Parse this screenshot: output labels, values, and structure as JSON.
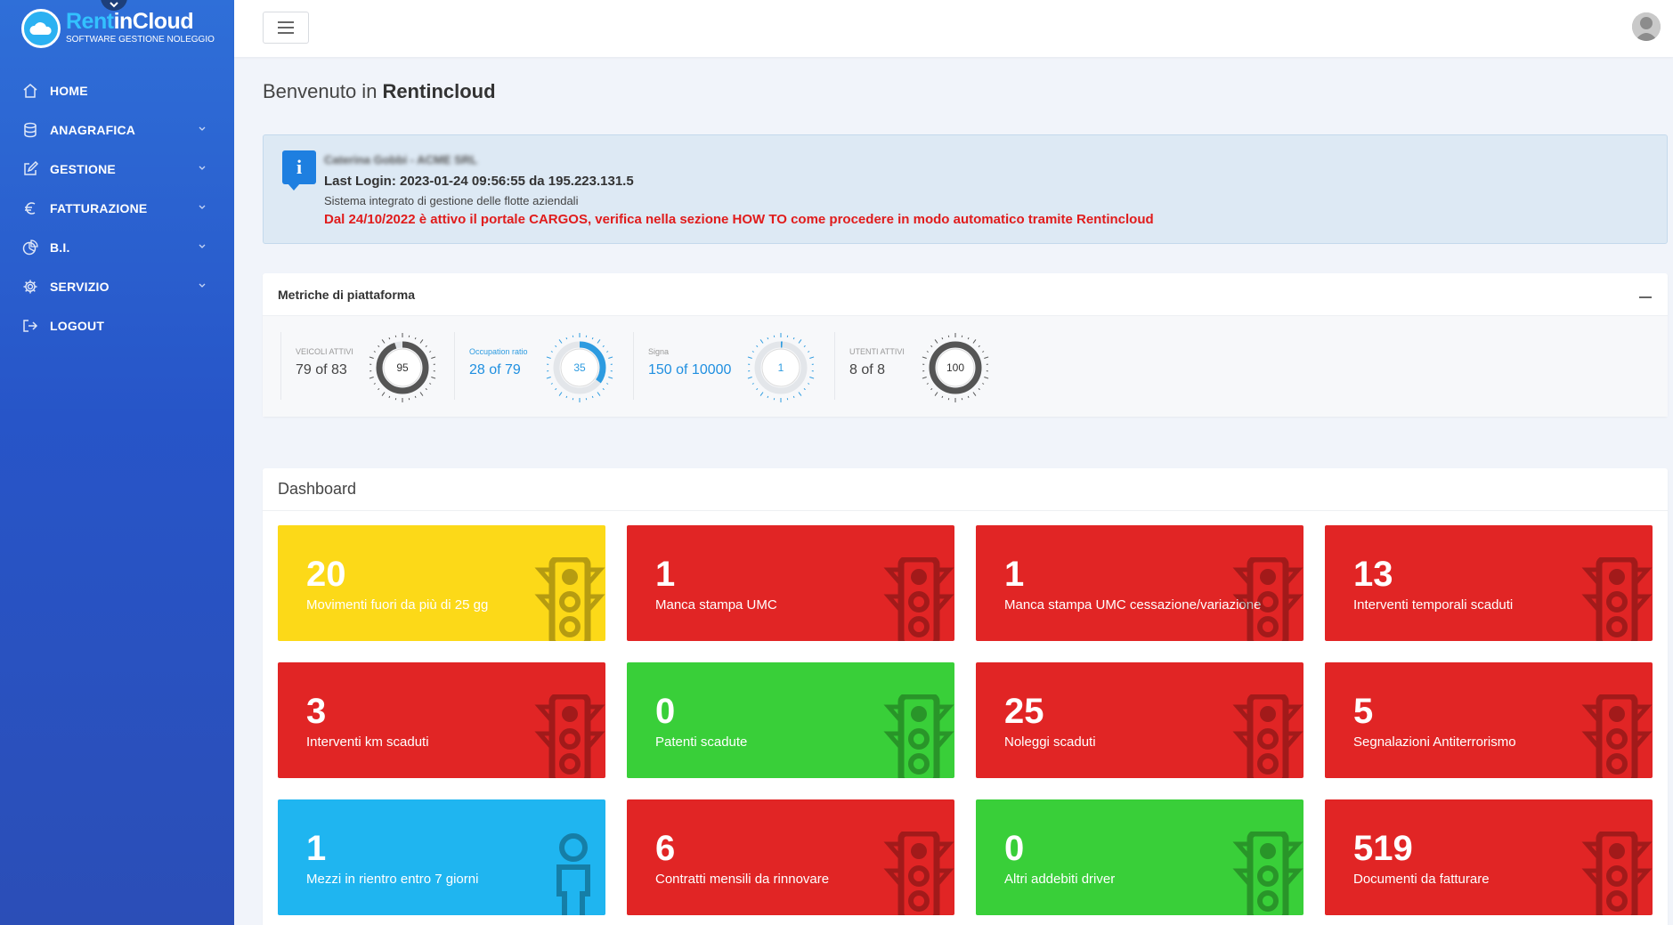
{
  "brand": {
    "name_part1": "Rent",
    "name_part2": "inCloud",
    "subtitle": "SOFTWARE GESTIONE NOLEGGIO",
    "accent_color": "#33c1ff",
    "sidebar_color": "#2755c8"
  },
  "sidebar": {
    "items": [
      {
        "label": "HOME",
        "icon": "home-icon",
        "has_submenu": false
      },
      {
        "label": "ANAGRAFICA",
        "icon": "database-icon",
        "has_submenu": true
      },
      {
        "label": "GESTIONE",
        "icon": "edit-icon",
        "has_submenu": true
      },
      {
        "label": "FATTURAZIONE",
        "icon": "euro-icon",
        "has_submenu": true
      },
      {
        "label": "B.I.",
        "icon": "pie-chart-icon",
        "has_submenu": true
      },
      {
        "label": "SERVIZIO",
        "icon": "gear-icon",
        "has_submenu": true
      },
      {
        "label": "LOGOUT",
        "icon": "logout-icon",
        "has_submenu": false
      }
    ]
  },
  "header": {
    "menu_icon": "hamburger-icon",
    "avatar_icon": "user-avatar-icon"
  },
  "welcome": {
    "prefix": "Benvenuto in",
    "app": "Rentincloud"
  },
  "info": {
    "user": "Caterina Gobbi - ACME SRL",
    "last_login": "Last Login: 2023-01-24 09:56:55 da 195.223.131.5",
    "description": "Sistema integrato di gestione delle flotte aziendali",
    "alert": "Dal 24/10/2022 è attivo il portale CARGOS, verifica nella sezione HOW TO come procedere in modo automatico tramite Rentincloud",
    "alert_color": "#e01c1c"
  },
  "metrics": {
    "title": "Metriche di piattaforma",
    "items": [
      {
        "label": "VEICOLI ATTIVI",
        "value": "79 of 83",
        "gauge": "95",
        "percent": 95,
        "color": "#555555"
      },
      {
        "label": "Occupation ratio",
        "value": "28 of 79",
        "gauge": "35",
        "percent": 35,
        "color": "#2d9be0"
      },
      {
        "label": "Signa",
        "value": "150 of 10000",
        "gauge": "1",
        "percent": 1,
        "color": "#2d9be0"
      },
      {
        "label": "UTENTI ATTIVI",
        "value": "8 of 8",
        "gauge": "100",
        "percent": 100,
        "color": "#555555"
      }
    ]
  },
  "dashboard": {
    "title": "Dashboard",
    "tiles": [
      {
        "value": "20",
        "label": "Movimenti fuori da più di 25 gg",
        "color": "#fcd918",
        "icon": "traffic-light-icon"
      },
      {
        "value": "1",
        "label": "Manca stampa UMC",
        "color": "#e12525",
        "icon": "traffic-light-icon"
      },
      {
        "value": "1",
        "label": "Manca stampa UMC cessazione/variazione",
        "color": "#e12525",
        "icon": "traffic-light-icon"
      },
      {
        "value": "13",
        "label": "Interventi temporali scaduti",
        "color": "#e12525",
        "icon": "traffic-light-icon"
      },
      {
        "value": "3",
        "label": "Interventi km scaduti",
        "color": "#e12525",
        "icon": "traffic-light-icon"
      },
      {
        "value": "0",
        "label": "Patenti scadute",
        "color": "#39cf39",
        "icon": "traffic-light-icon"
      },
      {
        "value": "25",
        "label": "Noleggi scaduti",
        "color": "#e12525",
        "icon": "traffic-light-icon"
      },
      {
        "value": "5",
        "label": "Segnalazioni Antiterrorismo",
        "color": "#e12525",
        "icon": "traffic-light-icon"
      },
      {
        "value": "1",
        "label": "Mezzi in rientro entro 7 giorni",
        "color": "#1fb5f0",
        "icon": "person-icon"
      },
      {
        "value": "6",
        "label": "Contratti mensili da rinnovare",
        "color": "#e12525",
        "icon": "traffic-light-icon"
      },
      {
        "value": "0",
        "label": "Altri addebiti driver",
        "color": "#39cf39",
        "icon": "traffic-light-icon"
      },
      {
        "value": "519",
        "label": "Documenti da fatturare",
        "color": "#e12525",
        "icon": "traffic-light-icon"
      }
    ]
  }
}
